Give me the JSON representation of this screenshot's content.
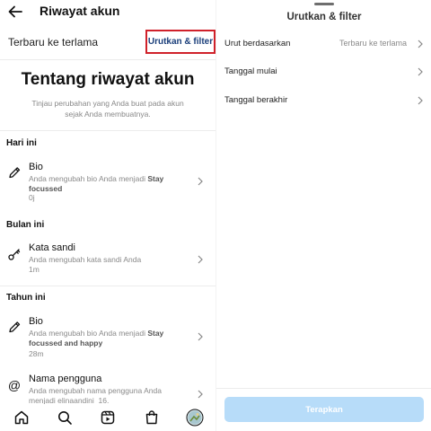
{
  "header": {
    "title": "Riwayat akun"
  },
  "sort_row": {
    "label": "Terbaru ke terlama",
    "filter_button": "Urutkan & filter"
  },
  "about": {
    "title": "Tentang riwayat akun",
    "description": "Tinjau perubahan yang Anda buat pada akun sejak Anda membuatnya."
  },
  "sections": {
    "today": "Hari ini",
    "this_month": "Bulan ini",
    "this_year": "Tahun ini"
  },
  "entries": {
    "bio1": {
      "title": "Bio",
      "desc_prefix": "Anda mengubah bio Anda menjadi ",
      "desc_bold": "Stay focussed",
      "time": "0j",
      "icon": "pencil-icon"
    },
    "password": {
      "title": "Kata sandi",
      "desc": "Anda mengubah kata sandi Anda",
      "time": "1m",
      "icon": "key-icon"
    },
    "bio2": {
      "title": "Bio",
      "desc_prefix": "Anda mengubah bio Anda menjadi ",
      "desc_bold": "Stay focussed and happy",
      "time": "28m",
      "icon": "pencil-icon"
    },
    "username": {
      "title": "Nama pengguna",
      "desc": "Anda mengubah nama pengguna Anda menjadi elinaandini_16.",
      "icon": "at-sign-icon"
    }
  },
  "bottom_nav": [
    "home-icon",
    "search-icon",
    "reels-icon",
    "shop-icon",
    "profile-avatar"
  ],
  "sheet": {
    "title": "Urutkan & filter",
    "options": {
      "sort_by": {
        "label": "Urut berdasarkan",
        "value": "Terbaru ke terlama"
      },
      "start_date": {
        "label": "Tanggal mulai"
      },
      "end_date": {
        "label": "Tanggal berakhir"
      }
    },
    "apply_button": "Terapkan"
  },
  "colors": {
    "highlight_border": "#d0212a",
    "filter_text": "#1a3e7a",
    "apply_disabled": "#b7dcf9"
  }
}
